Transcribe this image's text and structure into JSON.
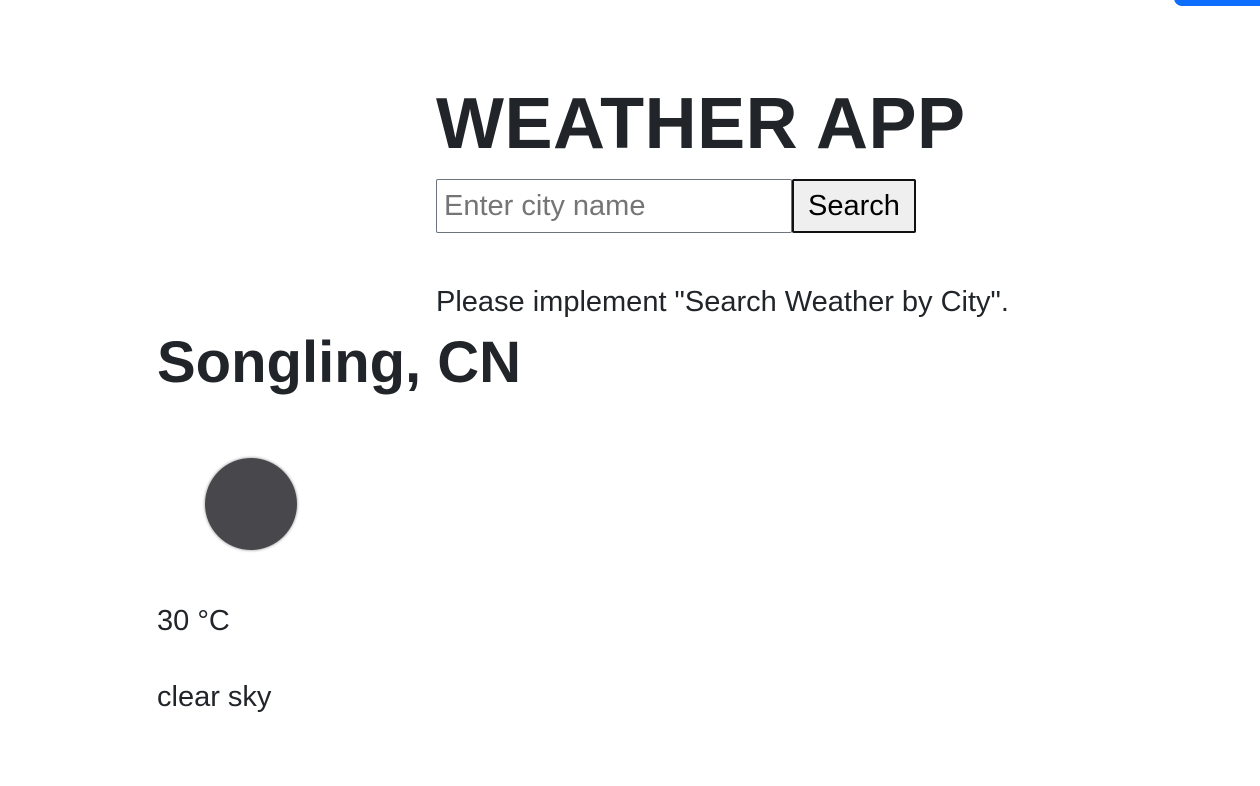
{
  "app": {
    "title": "WEATHER APP"
  },
  "search": {
    "placeholder": "Enter city name",
    "value": "",
    "button_label": "Search"
  },
  "notice": {
    "text": "Please implement \"Search Weather by City\"."
  },
  "weather": {
    "city": "Songling, CN",
    "icon": "weather-icon-dark-circle",
    "temperature": "30 °C",
    "description": "clear sky"
  },
  "colors": {
    "accent": "#0d6efd",
    "text": "#212529",
    "icon": "#48484c"
  }
}
